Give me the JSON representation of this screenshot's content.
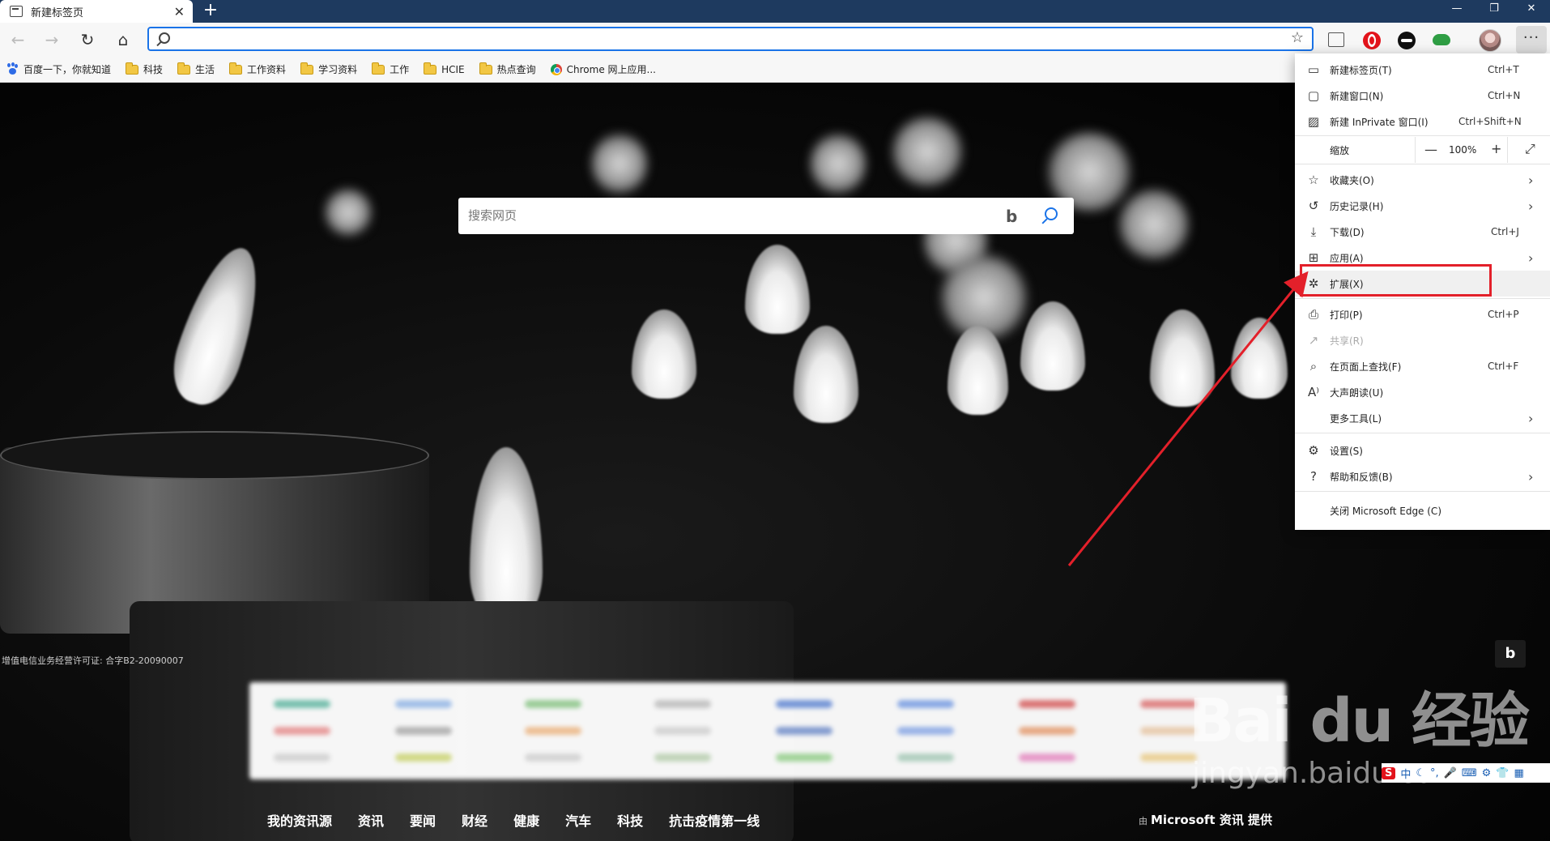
{
  "window": {
    "tab_title": "新建标签页",
    "tab_close": "✕",
    "new_tab": "+",
    "controls": {
      "minimize": "—",
      "restore": "❐",
      "close": "✕"
    }
  },
  "toolbar": {
    "back": "←",
    "forward": "→",
    "refresh": "↻",
    "home": "⌂",
    "address_value": "",
    "favorite_star": "☆",
    "more": "···"
  },
  "bookmarks": [
    {
      "label": "百度一下，你就知道",
      "icon": "paw-icon"
    },
    {
      "label": "科技",
      "icon": "folder-icon"
    },
    {
      "label": "生活",
      "icon": "folder-icon"
    },
    {
      "label": "工作资料",
      "icon": "folder-icon"
    },
    {
      "label": "学习资料",
      "icon": "folder-icon"
    },
    {
      "label": "工作",
      "icon": "folder-icon"
    },
    {
      "label": "HCIE",
      "icon": "folder-icon"
    },
    {
      "label": "热点查询",
      "icon": "folder-icon"
    },
    {
      "label": "Chrome 网上应用...",
      "icon": "chrome-icon"
    }
  ],
  "page": {
    "search_placeholder": "搜索网页",
    "bing_logo": "b",
    "license": "增值电信业务经营许可证: 合字B2-20090007",
    "bing_corner": "b",
    "news_tabs": [
      "我的资讯源",
      "资讯",
      "要闻",
      "财经",
      "健康",
      "汽车",
      "科技",
      "抗击疫情第一线"
    ],
    "news_credit_prefix": "由",
    "news_credit": "Microsoft 资讯 提供"
  },
  "menu": {
    "items": [
      {
        "label": "新建标签页(T)",
        "shortcut": "Ctrl+T",
        "icon": "new-tab-icon",
        "glyph": "▭"
      },
      {
        "label": "新建窗口(N)",
        "shortcut": "Ctrl+N",
        "icon": "new-window-icon",
        "glyph": "▢"
      },
      {
        "label": "新建 InPrivate 窗口(I)",
        "shortcut": "Ctrl+Shift+N",
        "icon": "inprivate-icon",
        "glyph": "▨"
      },
      {
        "label": "缩放",
        "zoom_value": "100%",
        "zoom_out": "—",
        "zoom_in": "+",
        "fullscreen": "⤢"
      },
      {
        "label": "收藏夹(O)",
        "icon": "favorites-icon",
        "glyph": "☆",
        "chevron": "›"
      },
      {
        "label": "历史记录(H)",
        "icon": "history-icon",
        "glyph": "↺",
        "chevron": "›"
      },
      {
        "label": "下载(D)",
        "shortcut": "Ctrl+J",
        "icon": "download-icon",
        "glyph": "⤓"
      },
      {
        "label": "应用(A)",
        "icon": "apps-icon",
        "glyph": "⊞",
        "chevron": "›"
      },
      {
        "label": "扩展(X)",
        "icon": "extensions-icon",
        "glyph": "✲"
      },
      {
        "label": "打印(P)",
        "shortcut": "Ctrl+P",
        "icon": "print-icon",
        "glyph": "⎙"
      },
      {
        "label": "共享(R)",
        "icon": "share-icon",
        "glyph": "↗",
        "disabled": true
      },
      {
        "label": "在页面上查找(F)",
        "shortcut": "Ctrl+F",
        "icon": "find-icon",
        "glyph": "⌕"
      },
      {
        "label": "大声朗读(U)",
        "icon": "read-aloud-icon",
        "glyph": "A⁾"
      },
      {
        "label": "更多工具(L)",
        "chevron": "›"
      },
      {
        "label": "设置(S)",
        "icon": "settings-icon",
        "glyph": "⚙"
      },
      {
        "label": "帮助和反馈(B)",
        "icon": "help-icon",
        "glyph": "?",
        "chevron": "›"
      },
      {
        "label": "关闭 Microsoft Edge (C)"
      }
    ]
  },
  "watermark": {
    "logo": "Bai du 经验",
    "url": "jingyan.baidu.com",
    "ime": [
      "S",
      "中",
      "☾",
      "°,",
      "🎤",
      "⌨",
      "⚙",
      "👕",
      "▦"
    ]
  },
  "colors": {
    "highlight": "#e3202a",
    "titlebar": "#1e3a5f",
    "accent": "#1a73e8"
  }
}
